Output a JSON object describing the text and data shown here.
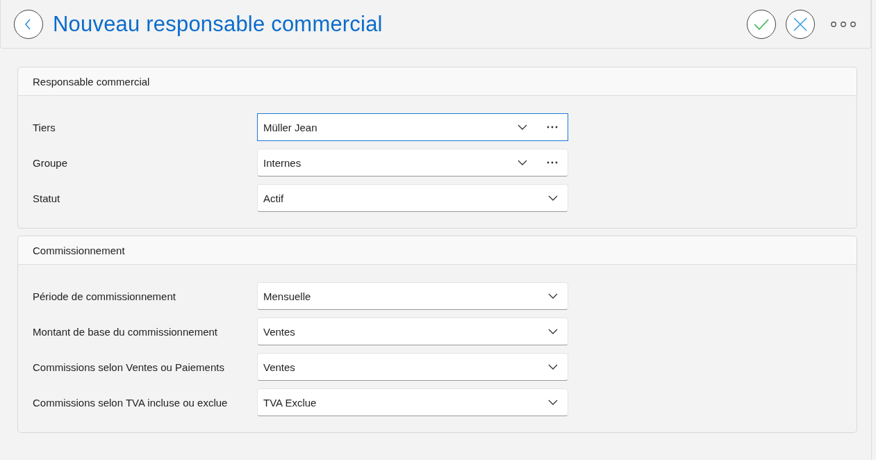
{
  "header": {
    "title": "Nouveau responsable commercial"
  },
  "sections": [
    {
      "title": "Responsable commercial",
      "fields": [
        {
          "label": "Tiers",
          "value": "Müller Jean",
          "focused": true,
          "browse": true
        },
        {
          "label": "Groupe",
          "value": "Internes",
          "focused": false,
          "browse": true
        },
        {
          "label": "Statut",
          "value": "Actif",
          "focused": false,
          "browse": false
        }
      ]
    },
    {
      "title": "Commissionnement",
      "fields": [
        {
          "label": "Période de commissionnement",
          "value": "Mensuelle",
          "focused": false,
          "browse": false
        },
        {
          "label": "Montant de base du commissionnement",
          "value": "Ventes",
          "focused": false,
          "browse": false
        },
        {
          "label": "Commissions selon Ventes ou Paiements",
          "value": "Ventes",
          "focused": false,
          "browse": false
        },
        {
          "label": "Commissions selon TVA incluse ou exclue",
          "value": "TVA Exclue",
          "focused": false,
          "browse": false
        }
      ]
    }
  ]
}
